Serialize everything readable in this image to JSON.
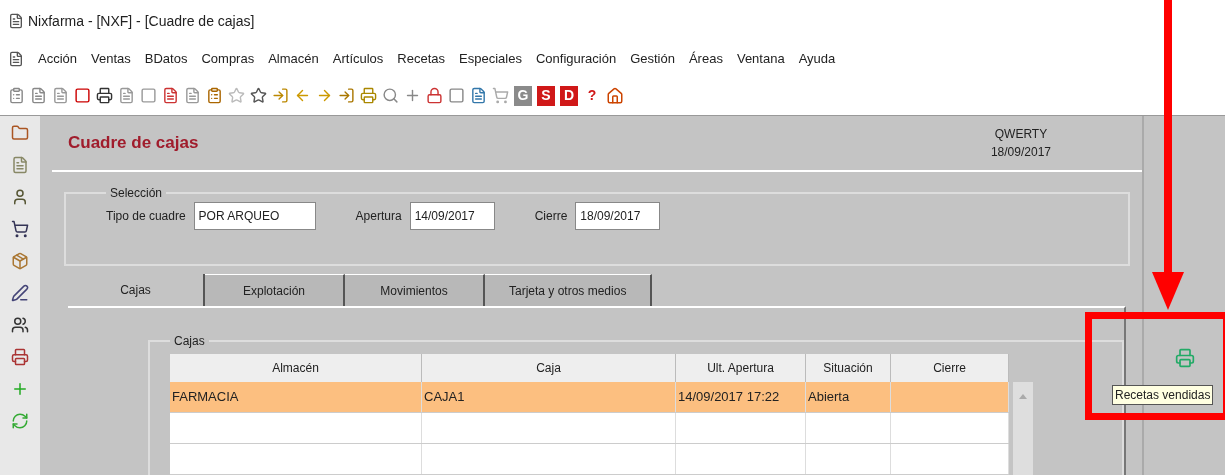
{
  "window": {
    "title": "Nixfarma - [NXF] - [Cuadre de cajas]"
  },
  "menu": [
    "Acción",
    "Ventas",
    "BDatos",
    "Compras",
    "Almacén",
    "Artículos",
    "Recetas",
    "Especiales",
    "Configuración",
    "Gestión",
    "Áreas",
    "Ventana",
    "Ayuda"
  ],
  "toolbar_letters": [
    {
      "label": "G",
      "kind": "grey"
    },
    {
      "label": "S",
      "kind": "red"
    },
    {
      "label": "D",
      "kind": "red"
    },
    {
      "label": "?",
      "kind": "plain"
    }
  ],
  "panel": {
    "title": "Cuadre de cajas",
    "user": "QWERTY",
    "date": "18/09/2017"
  },
  "seleccion": {
    "legend": "Selección",
    "fields": [
      {
        "label": "Tipo de cuadre",
        "value": "POR ARQUEO"
      },
      {
        "label": "Apertura",
        "value": "14/09/2017"
      },
      {
        "label": "Cierre",
        "value": "18/09/2017"
      }
    ]
  },
  "tabs": [
    {
      "label": "Cajas",
      "selected": true
    },
    {
      "label": "Explotación",
      "selected": false
    },
    {
      "label": "Movimientos",
      "selected": false
    },
    {
      "label": "Tarjeta y otros medios",
      "selected": false
    }
  ],
  "cajas": {
    "legend": "Cajas",
    "columns": [
      "Almacén",
      "Caja",
      "Ult. Apertura",
      "Situación",
      "Cierre"
    ],
    "rows": [
      {
        "cells": [
          "FARMACIA",
          "CAJA1",
          "14/09/2017 17:22",
          "Abierta",
          ""
        ],
        "selected": true
      },
      {
        "cells": [
          "",
          "",
          "",
          "",
          ""
        ],
        "selected": false
      },
      {
        "cells": [
          "",
          "",
          "",
          "",
          ""
        ],
        "selected": false
      }
    ]
  },
  "tooltip": "Recetas vendidas"
}
